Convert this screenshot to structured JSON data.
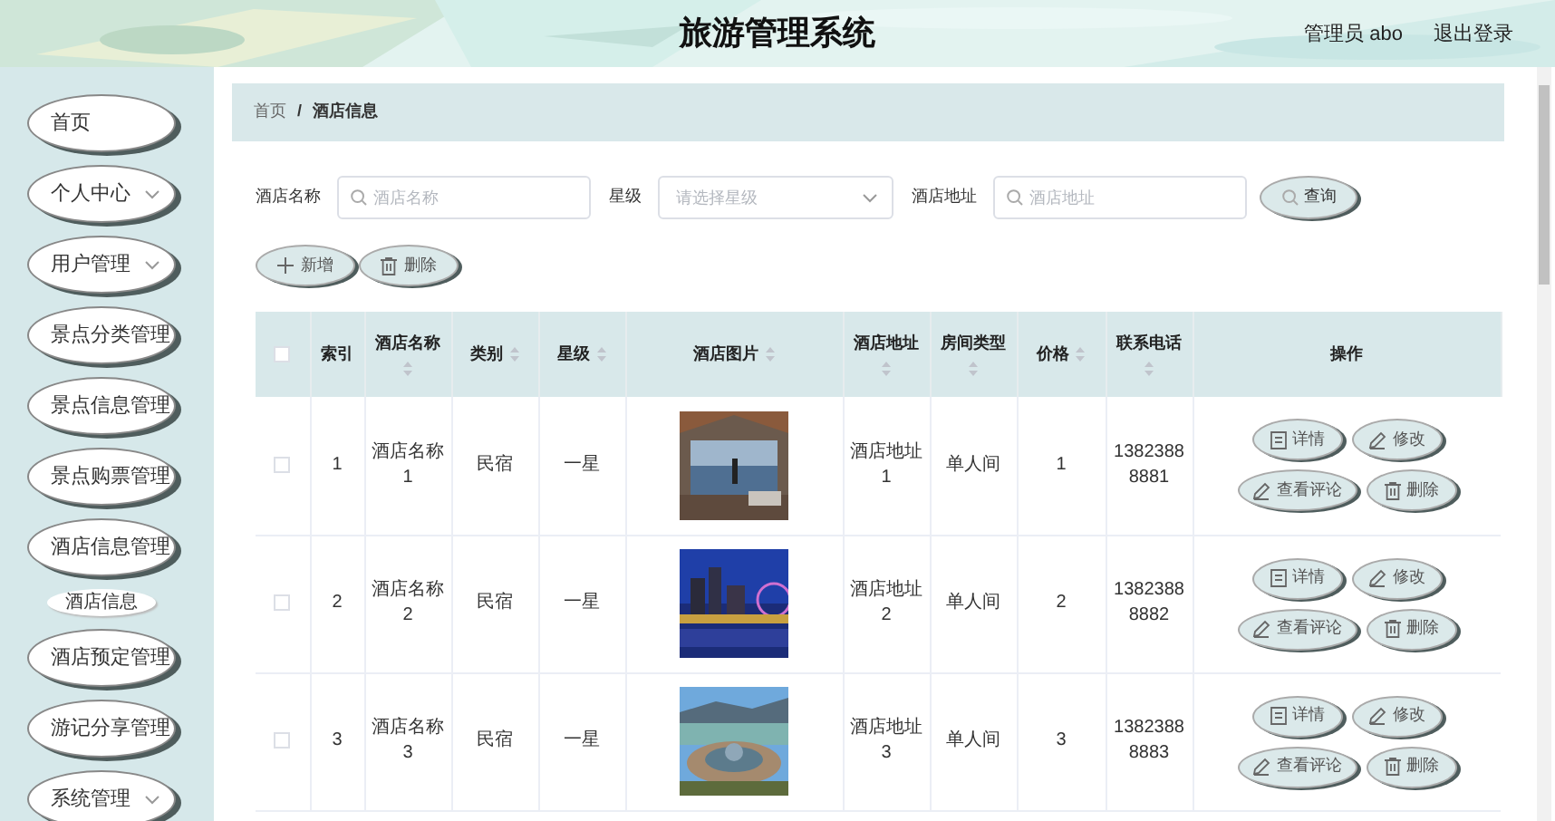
{
  "header": {
    "title": "旅游管理系统",
    "user": "管理员 abo",
    "logout": "退出登录"
  },
  "sidebar": {
    "items": [
      {
        "label": "首页",
        "kind": "item"
      },
      {
        "label": "个人中心",
        "kind": "menu"
      },
      {
        "label": "用户管理",
        "kind": "menu"
      },
      {
        "label": "景点分类管理",
        "kind": "item"
      },
      {
        "label": "景点信息管理",
        "kind": "item"
      },
      {
        "label": "景点购票管理",
        "kind": "item"
      },
      {
        "label": "酒店信息管理",
        "kind": "item",
        "children": [
          {
            "label": "酒店信息"
          }
        ]
      },
      {
        "label": "酒店预定管理",
        "kind": "item"
      },
      {
        "label": "游记分享管理",
        "kind": "item"
      },
      {
        "label": "系统管理",
        "kind": "menu"
      }
    ]
  },
  "breadcrumb": {
    "items": [
      "首页",
      "酒店信息"
    ],
    "separator": "/"
  },
  "search": {
    "fields": [
      {
        "label": "酒店名称",
        "placeholder": "酒店名称",
        "kind": "input"
      },
      {
        "label": "星级",
        "placeholder": "请选择星级",
        "kind": "select"
      },
      {
        "label": "酒店地址",
        "placeholder": "酒店地址",
        "kind": "input"
      }
    ],
    "button": "查询"
  },
  "toolbar": [
    {
      "label": "新增",
      "kind": "add"
    },
    {
      "label": "删除",
      "kind": "delete"
    }
  ],
  "table": {
    "select_all_checked": false,
    "columns": [
      {
        "label": "索引",
        "sortable": false
      },
      {
        "label": "酒店名称",
        "sortable": true
      },
      {
        "label": "类别",
        "sortable": true
      },
      {
        "label": "星级",
        "sortable": true
      },
      {
        "label": "酒店图片",
        "sortable": true
      },
      {
        "label": "酒店地址",
        "sortable": true
      },
      {
        "label": "房间类型",
        "sortable": true
      },
      {
        "label": "价格",
        "sortable": true
      },
      {
        "label": "联系电话",
        "sortable": true
      },
      {
        "label": "操作",
        "sortable": false
      }
    ],
    "rows": [
      {
        "checked": false,
        "cells": [
          "1",
          "酒店名称1",
          "民宿",
          "一星",
          null,
          "酒店地址1",
          "单人间",
          "1",
          "13823888881"
        ],
        "picture": {
          "kind": "picture"
        },
        "actions": [
          {
            "label": "详情",
            "kind": "detail"
          },
          {
            "label": "修改",
            "kind": "edit"
          },
          {
            "label": "查看评论",
            "kind": "edit"
          },
          {
            "label": "删除",
            "kind": "delete"
          }
        ]
      },
      {
        "checked": false,
        "cells": [
          "2",
          "酒店名称2",
          "民宿",
          "一星",
          null,
          "酒店地址2",
          "单人间",
          "2",
          "13823888882"
        ],
        "picture": {
          "kind": "picture"
        },
        "actions": [
          {
            "label": "详情",
            "kind": "detail"
          },
          {
            "label": "修改",
            "kind": "edit"
          },
          {
            "label": "查看评论",
            "kind": "edit"
          },
          {
            "label": "删除",
            "kind": "delete"
          }
        ]
      },
      {
        "checked": false,
        "cells": [
          "3",
          "酒店名称3",
          "民宿",
          "一星",
          null,
          "酒店地址3",
          "单人间",
          "3",
          "13823888883"
        ],
        "picture": {
          "kind": "picture"
        },
        "actions": [
          {
            "label": "详情",
            "kind": "detail"
          },
          {
            "label": "修改",
            "kind": "edit"
          },
          {
            "label": "查看评论",
            "kind": "edit"
          },
          {
            "label": "删除",
            "kind": "delete"
          }
        ]
      }
    ]
  }
}
